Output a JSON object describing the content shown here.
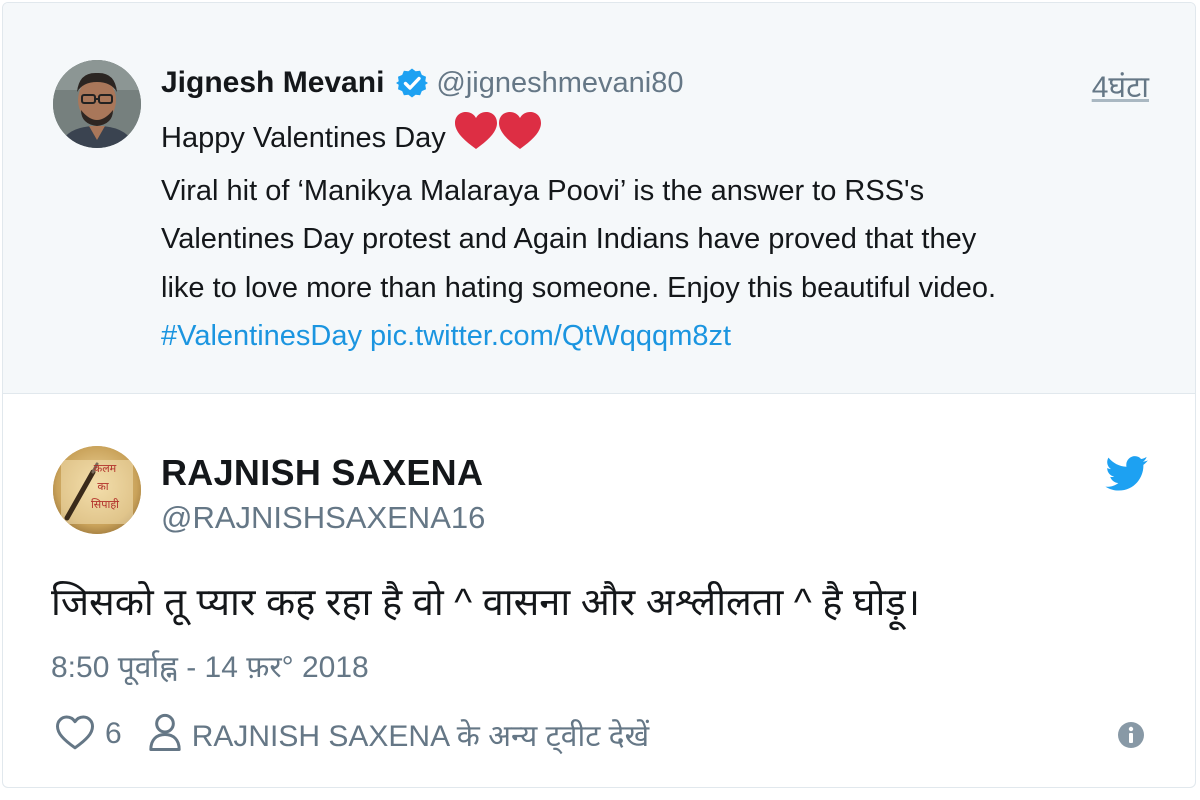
{
  "parent_tweet": {
    "author_name": "Jignesh Mevani",
    "handle": "@jigneshmevani80",
    "time": "4घंटा",
    "line1": "Happy Valentines Day",
    "line2": "Viral hit of ‘Manikya Malaraya Poovi’ is the answer to RSS's",
    "line3": "Valentines Day protest and Again Indians have proved that they",
    "line4": "like to love more than hating someone. Enjoy this beautiful video.",
    "hashtag": "#ValentinesDay",
    "pic_link": "pic.twitter.com/QtWqqqm8zt",
    "avatar_icon": "profile-photo",
    "verified_icon": "verified-badge-icon",
    "emoji_icon": "red-heart-emoji"
  },
  "main_tweet": {
    "author_name": "RAJNISH SAXENA",
    "handle": "@RAJNISHSAXENA16",
    "text": "जिसको तू प्यार कह रहा है वो ^ वासना और अश्लीलता ^ है घोड़ू।",
    "timestamp": "8:50 पूर्वाह्न - 14 फ़र° 2018",
    "like_count": "6",
    "view_more": "RAJNISH SAXENA के अन्य ट्वीट देखें",
    "avatar_text": [
      "कलम",
      "का",
      "सिपाही"
    ]
  },
  "colors": {
    "twitter_blue": "#1da1f2",
    "link_blue": "#1b95e0",
    "heart_red": "#e0245e",
    "muted_gray": "#657786",
    "text_dark": "#14171a",
    "quote_bg": "#f5f8fa"
  }
}
